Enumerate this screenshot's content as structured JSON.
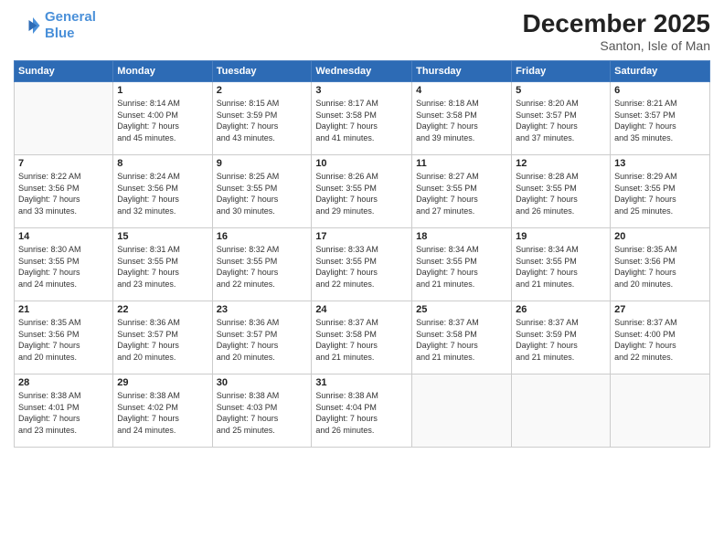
{
  "logo": {
    "line1": "General",
    "line2": "Blue"
  },
  "title": "December 2025",
  "subtitle": "Santon, Isle of Man",
  "days_header": [
    "Sunday",
    "Monday",
    "Tuesday",
    "Wednesday",
    "Thursday",
    "Friday",
    "Saturday"
  ],
  "weeks": [
    [
      {
        "day": "",
        "info": ""
      },
      {
        "day": "1",
        "info": "Sunrise: 8:14 AM\nSunset: 4:00 PM\nDaylight: 7 hours\nand 45 minutes."
      },
      {
        "day": "2",
        "info": "Sunrise: 8:15 AM\nSunset: 3:59 PM\nDaylight: 7 hours\nand 43 minutes."
      },
      {
        "day": "3",
        "info": "Sunrise: 8:17 AM\nSunset: 3:58 PM\nDaylight: 7 hours\nand 41 minutes."
      },
      {
        "day": "4",
        "info": "Sunrise: 8:18 AM\nSunset: 3:58 PM\nDaylight: 7 hours\nand 39 minutes."
      },
      {
        "day": "5",
        "info": "Sunrise: 8:20 AM\nSunset: 3:57 PM\nDaylight: 7 hours\nand 37 minutes."
      },
      {
        "day": "6",
        "info": "Sunrise: 8:21 AM\nSunset: 3:57 PM\nDaylight: 7 hours\nand 35 minutes."
      }
    ],
    [
      {
        "day": "7",
        "info": "Sunrise: 8:22 AM\nSunset: 3:56 PM\nDaylight: 7 hours\nand 33 minutes."
      },
      {
        "day": "8",
        "info": "Sunrise: 8:24 AM\nSunset: 3:56 PM\nDaylight: 7 hours\nand 32 minutes."
      },
      {
        "day": "9",
        "info": "Sunrise: 8:25 AM\nSunset: 3:55 PM\nDaylight: 7 hours\nand 30 minutes."
      },
      {
        "day": "10",
        "info": "Sunrise: 8:26 AM\nSunset: 3:55 PM\nDaylight: 7 hours\nand 29 minutes."
      },
      {
        "day": "11",
        "info": "Sunrise: 8:27 AM\nSunset: 3:55 PM\nDaylight: 7 hours\nand 27 minutes."
      },
      {
        "day": "12",
        "info": "Sunrise: 8:28 AM\nSunset: 3:55 PM\nDaylight: 7 hours\nand 26 minutes."
      },
      {
        "day": "13",
        "info": "Sunrise: 8:29 AM\nSunset: 3:55 PM\nDaylight: 7 hours\nand 25 minutes."
      }
    ],
    [
      {
        "day": "14",
        "info": "Sunrise: 8:30 AM\nSunset: 3:55 PM\nDaylight: 7 hours\nand 24 minutes."
      },
      {
        "day": "15",
        "info": "Sunrise: 8:31 AM\nSunset: 3:55 PM\nDaylight: 7 hours\nand 23 minutes."
      },
      {
        "day": "16",
        "info": "Sunrise: 8:32 AM\nSunset: 3:55 PM\nDaylight: 7 hours\nand 22 minutes."
      },
      {
        "day": "17",
        "info": "Sunrise: 8:33 AM\nSunset: 3:55 PM\nDaylight: 7 hours\nand 22 minutes."
      },
      {
        "day": "18",
        "info": "Sunrise: 8:34 AM\nSunset: 3:55 PM\nDaylight: 7 hours\nand 21 minutes."
      },
      {
        "day": "19",
        "info": "Sunrise: 8:34 AM\nSunset: 3:55 PM\nDaylight: 7 hours\nand 21 minutes."
      },
      {
        "day": "20",
        "info": "Sunrise: 8:35 AM\nSunset: 3:56 PM\nDaylight: 7 hours\nand 20 minutes."
      }
    ],
    [
      {
        "day": "21",
        "info": "Sunrise: 8:35 AM\nSunset: 3:56 PM\nDaylight: 7 hours\nand 20 minutes."
      },
      {
        "day": "22",
        "info": "Sunrise: 8:36 AM\nSunset: 3:57 PM\nDaylight: 7 hours\nand 20 minutes."
      },
      {
        "day": "23",
        "info": "Sunrise: 8:36 AM\nSunset: 3:57 PM\nDaylight: 7 hours\nand 20 minutes."
      },
      {
        "day": "24",
        "info": "Sunrise: 8:37 AM\nSunset: 3:58 PM\nDaylight: 7 hours\nand 21 minutes."
      },
      {
        "day": "25",
        "info": "Sunrise: 8:37 AM\nSunset: 3:58 PM\nDaylight: 7 hours\nand 21 minutes."
      },
      {
        "day": "26",
        "info": "Sunrise: 8:37 AM\nSunset: 3:59 PM\nDaylight: 7 hours\nand 21 minutes."
      },
      {
        "day": "27",
        "info": "Sunrise: 8:37 AM\nSunset: 4:00 PM\nDaylight: 7 hours\nand 22 minutes."
      }
    ],
    [
      {
        "day": "28",
        "info": "Sunrise: 8:38 AM\nSunset: 4:01 PM\nDaylight: 7 hours\nand 23 minutes."
      },
      {
        "day": "29",
        "info": "Sunrise: 8:38 AM\nSunset: 4:02 PM\nDaylight: 7 hours\nand 24 minutes."
      },
      {
        "day": "30",
        "info": "Sunrise: 8:38 AM\nSunset: 4:03 PM\nDaylight: 7 hours\nand 25 minutes."
      },
      {
        "day": "31",
        "info": "Sunrise: 8:38 AM\nSunset: 4:04 PM\nDaylight: 7 hours\nand 26 minutes."
      },
      {
        "day": "",
        "info": ""
      },
      {
        "day": "",
        "info": ""
      },
      {
        "day": "",
        "info": ""
      }
    ]
  ]
}
